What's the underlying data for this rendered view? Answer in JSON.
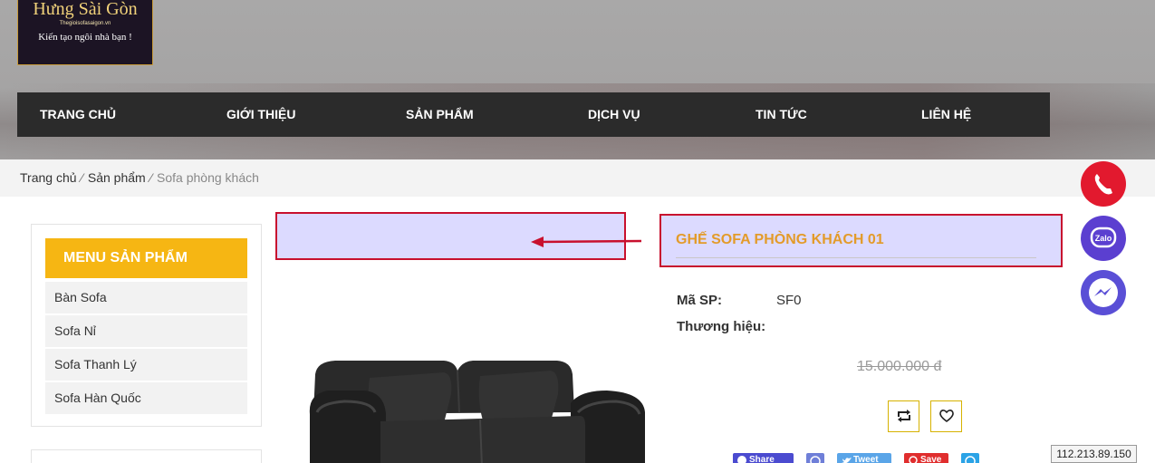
{
  "header": {
    "logo": {
      "title": "Hưng Sài Gòn",
      "site": "Thegioisofasaigon.vn",
      "slogan": "Kiến tạo ngôi nhà bạn !"
    },
    "nav": [
      "TRANG CHỦ",
      "GIỚI THIỆU",
      "SẢN PHẨM",
      "DỊCH VỤ",
      "TIN TỨC",
      "LIÊN HỆ"
    ]
  },
  "breadcrumb": {
    "items": [
      "Trang chủ",
      "Sản phẩm"
    ],
    "current": "Sofa phòng khách",
    "separator": "⁄"
  },
  "sidebar": {
    "title": "MENU SẢN PHẨM",
    "items": [
      "Bàn Sofa",
      "Sofa Nỉ",
      "Sofa Thanh Lý",
      "Sofa Hàn Quốc"
    ]
  },
  "product": {
    "title": "GHẾ SOFA PHÒNG KHÁCH 01",
    "sku_label": "Mã SP:",
    "sku_value": "SF0",
    "brand_label": "Thương hiệu:",
    "old_price": "15.000.000 đ"
  },
  "share": {
    "facebook": "Share",
    "twitter": "Tweet",
    "pinterest": "Save"
  },
  "ip": "112.213.89.150",
  "colors": {
    "nav_bg": "#2b2b2b",
    "sidebar_title_bg": "#f6b613",
    "product_title": "#e39b2a",
    "highlight_border": "#c8102e",
    "highlight_fill": "#dcdaff",
    "phone_button": "#e2192e",
    "zalo_button": "#5b3fd0",
    "messenger_button": "#5a4fd6"
  },
  "icons": [
    "phone-icon",
    "zalo-icon",
    "messenger-icon",
    "compare-icon",
    "heart-icon",
    "facebook-icon",
    "messenger-share-icon",
    "twitter-icon",
    "pinterest-icon",
    "skype-icon"
  ]
}
